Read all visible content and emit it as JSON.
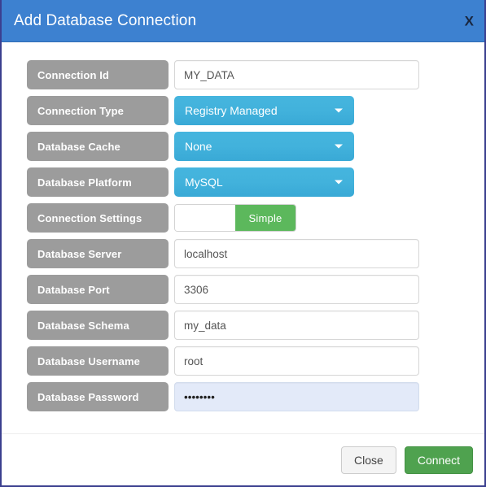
{
  "dialog": {
    "title": "Add Database Connection",
    "close_label": "X"
  },
  "form": {
    "rows": [
      {
        "label": "Connection Id",
        "control": "text",
        "value": "MY_DATA",
        "placeholder": ""
      },
      {
        "label": "Connection Type",
        "control": "dropdown",
        "value": "Registry Managed"
      },
      {
        "label": "Database Cache",
        "control": "dropdown",
        "value": "None"
      },
      {
        "label": "Database Platform",
        "control": "dropdown",
        "value": "MySQL"
      },
      {
        "label": "Connection Settings",
        "control": "toggle",
        "value": "Simple"
      },
      {
        "label": "Database Server",
        "control": "text",
        "value": "localhost",
        "placeholder": ""
      },
      {
        "label": "Database Port",
        "control": "text",
        "value": "3306",
        "placeholder": ""
      },
      {
        "label": "Database Schema",
        "control": "text",
        "value": "my_data",
        "placeholder": ""
      },
      {
        "label": "Database Username",
        "control": "text",
        "value": "root",
        "placeholder": ""
      },
      {
        "label": "Database Password",
        "control": "password",
        "value": "••••••••",
        "placeholder": ""
      }
    ]
  },
  "footer": {
    "close_label": "Close",
    "connect_label": "Connect"
  },
  "colors": {
    "header_blue": "#3d81d0",
    "label_gray": "#9c9c9c",
    "dropdown_cyan": "#42b2dc",
    "toggle_green": "#5cb85c",
    "connect_green": "#4fa24f",
    "dialog_border": "#3b3f8f",
    "autofill_blue": "#e3eaf9"
  }
}
